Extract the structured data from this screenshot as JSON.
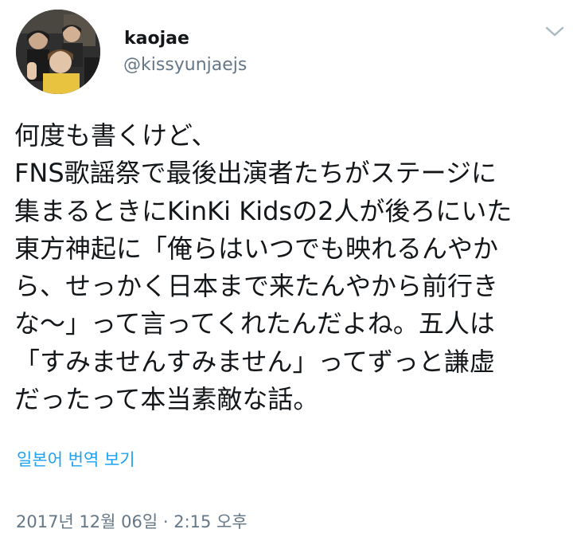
{
  "tweet": {
    "author": {
      "display_name": "kaojae",
      "handle": "@kissyunjaejs",
      "avatar_icon": "profile-photo"
    },
    "more_icon": "chevron-down-icon",
    "text_lines": [
      "何度も書くけど、",
      "FNS歌謡祭で最後出演者たちがステージに",
      "集まるときにKinKi Kidsの2人が後ろにいた",
      "東方神起に「俺らはいつでも映れるんやか",
      "ら、せっかく日本まで来たんやから前行き",
      "な〜」って言ってくれたんだよね。五人は",
      "「すみませんすみません」ってずっと謙虚",
      "だったって本当素敵な話。"
    ],
    "translate_label": "일본어 번역 보기",
    "timestamp": "2017년 12월 06일 · 2:15 오후"
  },
  "colors": {
    "text": "#14171a",
    "secondary": "#657786",
    "link": "#1da1f2",
    "background": "#ffffff"
  }
}
